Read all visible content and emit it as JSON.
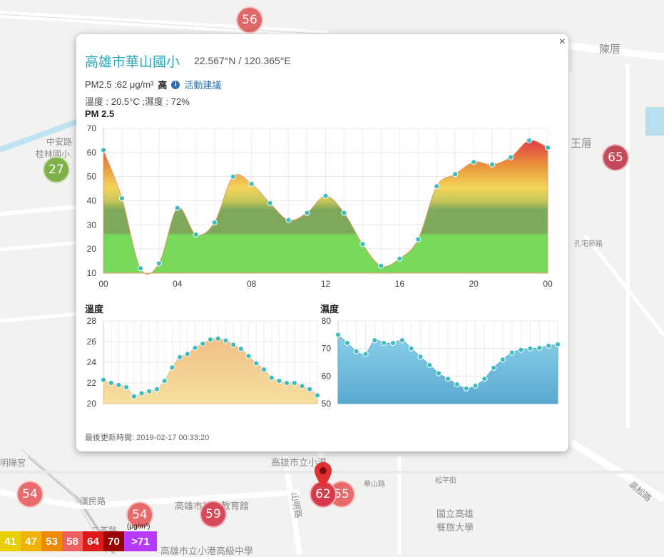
{
  "map": {
    "labels": [
      "中安路",
      "桂林國小",
      "陳厝",
      "王厝",
      "高雄市立小港",
      "高雄市社會教育館",
      "國立高雄餐旅大學",
      "高松路",
      "華山路",
      "松平街",
      "孔宅新路",
      "漢民路",
      "二苓路",
      "明陽宮",
      "山明路",
      "高雄市立小港高級中學"
    ],
    "markers": [
      {
        "value": "56",
        "color": "#e06868"
      },
      {
        "value": "27",
        "color": "#7fb04a"
      },
      {
        "value": "65",
        "color": "#c44a5a"
      },
      {
        "value": "54",
        "color": "#e86a6a"
      },
      {
        "value": "54",
        "color": "#e86a6a"
      },
      {
        "value": "59",
        "color": "#d64a5a"
      },
      {
        "value": "55",
        "color": "#e86a6a"
      },
      {
        "value": "62",
        "color": "#d63a4a"
      }
    ],
    "legend": [
      {
        "value": "41",
        "color": "#e8d000"
      },
      {
        "value": "47",
        "color": "#f0b400"
      },
      {
        "value": "53",
        "color": "#ee8a00"
      },
      {
        "value": "58",
        "color": "#ef6060"
      },
      {
        "value": "64",
        "color": "#e01818"
      },
      {
        "value": "70",
        "color": "#9a0000"
      },
      {
        "value": ">71",
        "color": "#b63aff"
      }
    ],
    "legend_unit": "(μg/m³)"
  },
  "popup": {
    "close": "×",
    "title": "高雄市華山國小",
    "coordinates": "22.567°N / 120.365°E",
    "pm_text": "PM2.5 :62 μg/m³",
    "pm_level": "高",
    "info_icon": "i",
    "advice_link": "活動建議",
    "temp_humidity": "溫度 : 20.5°C ;濕度 : 72%",
    "updated": "最後更新時間: 2019-02-17 00:33:20"
  },
  "chart_data": [
    {
      "type": "area",
      "title": "PM 2.5",
      "x": [
        "00",
        "01",
        "02",
        "03",
        "04",
        "05",
        "06",
        "07",
        "08",
        "09",
        "10",
        "11",
        "12",
        "13",
        "14",
        "15",
        "16",
        "17",
        "18",
        "19",
        "20",
        "21",
        "22",
        "23",
        "00"
      ],
      "xticks": [
        "00",
        "04",
        "08",
        "12",
        "16",
        "20",
        "00"
      ],
      "values": [
        61,
        41,
        12,
        14,
        37,
        26,
        31,
        50,
        47,
        39,
        32,
        35,
        42,
        35,
        22,
        13,
        16,
        24,
        46,
        51,
        56,
        55,
        58,
        65,
        62
      ],
      "ylim": [
        10,
        70
      ],
      "yticks": [
        10,
        20,
        30,
        40,
        50,
        60,
        70
      ],
      "grid": true
    },
    {
      "type": "area",
      "title": "溫度",
      "values": [
        22.3,
        22.0,
        21.8,
        21.6,
        20.7,
        21.0,
        21.2,
        21.4,
        22.2,
        23.5,
        24.5,
        24.8,
        25.4,
        25.8,
        26.2,
        26.3,
        26.1,
        25.7,
        25.3,
        24.6,
        23.9,
        23.3,
        22.5,
        22.2,
        22.0,
        22.0,
        21.7,
        21.4,
        20.8
      ],
      "ylim": [
        20,
        28
      ],
      "yticks": [
        20,
        22,
        24,
        26,
        28
      ],
      "grid": true
    },
    {
      "type": "area",
      "title": "濕度",
      "values": [
        75,
        72,
        69,
        68,
        73,
        72,
        72,
        73,
        70,
        67,
        64,
        61,
        59,
        57,
        55.5,
        56.5,
        59,
        63,
        66,
        68.5,
        69.5,
        70,
        70.2,
        71,
        71.5
      ],
      "ylim": [
        50,
        80
      ],
      "yticks": [
        50,
        60,
        70,
        80
      ],
      "grid": true
    }
  ]
}
